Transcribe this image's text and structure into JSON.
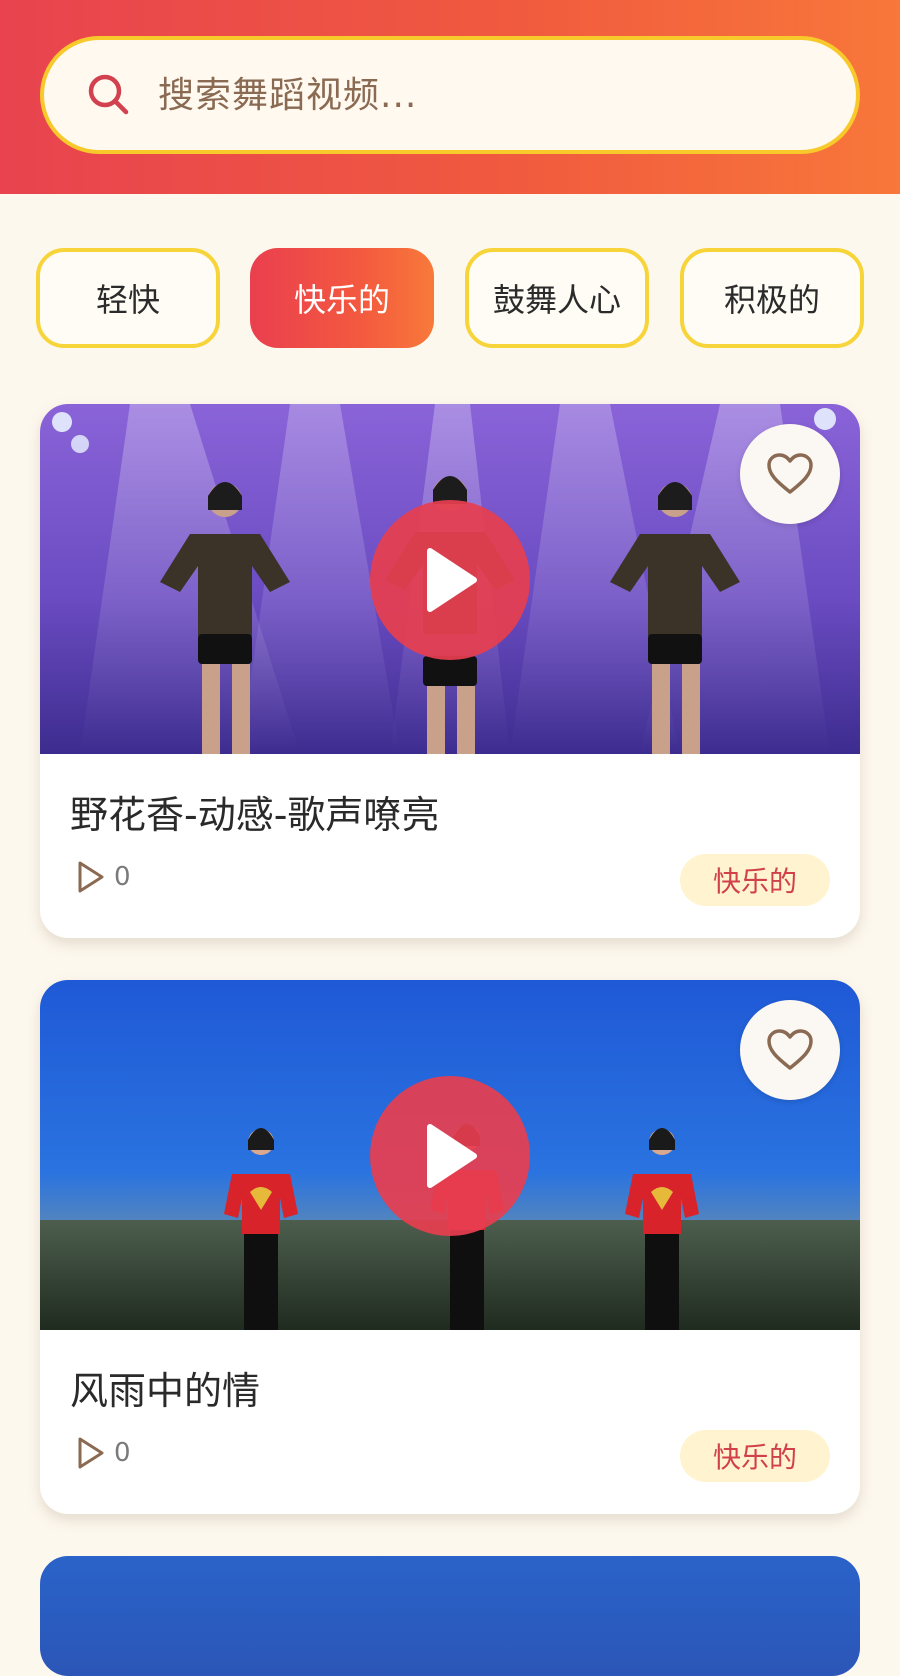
{
  "search": {
    "placeholder": "搜索舞蹈视频...",
    "icon": "search-icon"
  },
  "categories": [
    {
      "label": "轻快",
      "active": false
    },
    {
      "label": "快乐的",
      "active": true
    },
    {
      "label": "鼓舞人心",
      "active": false
    },
    {
      "label": "积极的",
      "active": false
    }
  ],
  "videos": [
    {
      "title": "野花香-动感-歌声嘹亮",
      "plays": "0",
      "tag": "快乐的"
    },
    {
      "title": "风雨中的情",
      "plays": "0",
      "tag": "快乐的"
    }
  ],
  "colors": {
    "header_gradient_start": "#e8434f",
    "header_gradient_end": "#f8773a",
    "chip_border": "#f7d43a",
    "play_button": "#e63e50",
    "tag_bg": "#fff4cf",
    "tag_text": "#d0414a",
    "background": "#fdf8ee"
  }
}
